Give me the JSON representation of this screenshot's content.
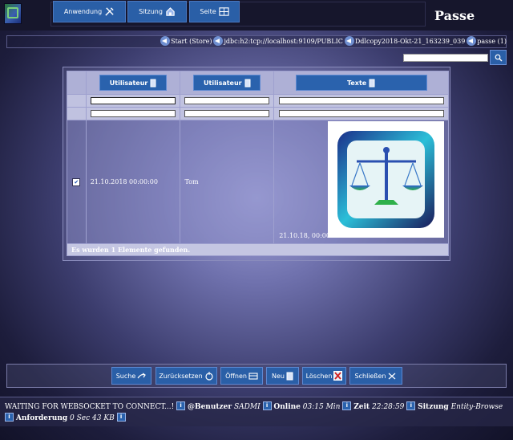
{
  "app": {
    "page_title": "Passe"
  },
  "menu": [
    {
      "label": "Anwendung",
      "icon": "tools-icon"
    },
    {
      "label": "Sitzung",
      "icon": "home-icon"
    },
    {
      "label": "Seite",
      "icon": "grid-icon"
    }
  ],
  "breadcrumbs": [
    "Start (Store)",
    "jdbc:h2:tcp://localhost:9109/PUBLIC",
    "Ddlcopy2018-Okt-21_163239_039",
    "passe (1)"
  ],
  "search": {
    "value": "",
    "button_icon": "search-icon"
  },
  "table": {
    "columns": [
      {
        "label": "Utilisateur",
        "icon": "sort-icon"
      },
      {
        "label": "Utilisateur",
        "icon": "sort-icon"
      },
      {
        "label": "Texte",
        "icon": "sort-icon"
      }
    ],
    "filter_rows": [
      [
        "",
        "",
        ""
      ],
      [
        "",
        "",
        ""
      ]
    ],
    "rows": [
      {
        "checked": true,
        "col1": "21.10.2018 00:00:00",
        "col2": "Tom",
        "col3": "21.10.18, 00:00",
        "image": "scales-of-justice-image"
      }
    ],
    "footer": "Es wurden 1 Elemente gefunden."
  },
  "actions": [
    {
      "label": "Suche",
      "icon": "arrow-icon"
    },
    {
      "label": "Zurücksetzen",
      "icon": "reset-icon"
    },
    {
      "label": "Öffnen",
      "icon": "open-icon"
    },
    {
      "label": "Neu",
      "icon": "new-icon"
    },
    {
      "label": "Löschen",
      "icon": "delete-icon"
    },
    {
      "label": "Schließen",
      "icon": "close-icon"
    }
  ],
  "status": {
    "message": "WAITING FOR WEBSOCKET TO CONNECT...!",
    "user_label": "@Benutzer",
    "user_value": "SADMI",
    "online_label": "Online",
    "online_value": "03:15 Min",
    "time_label": "Zeit",
    "time_value": "22:28:59",
    "session_label": "Sitzung",
    "session_value": "Entity-Browse",
    "request_label": "Anforderung",
    "request_value": "0 Sec 43",
    "request_unit": "KB"
  },
  "colors": {
    "accent": "#2a5fa7",
    "panel": "#aeb0d6",
    "background_center": "#9ea0d8"
  }
}
